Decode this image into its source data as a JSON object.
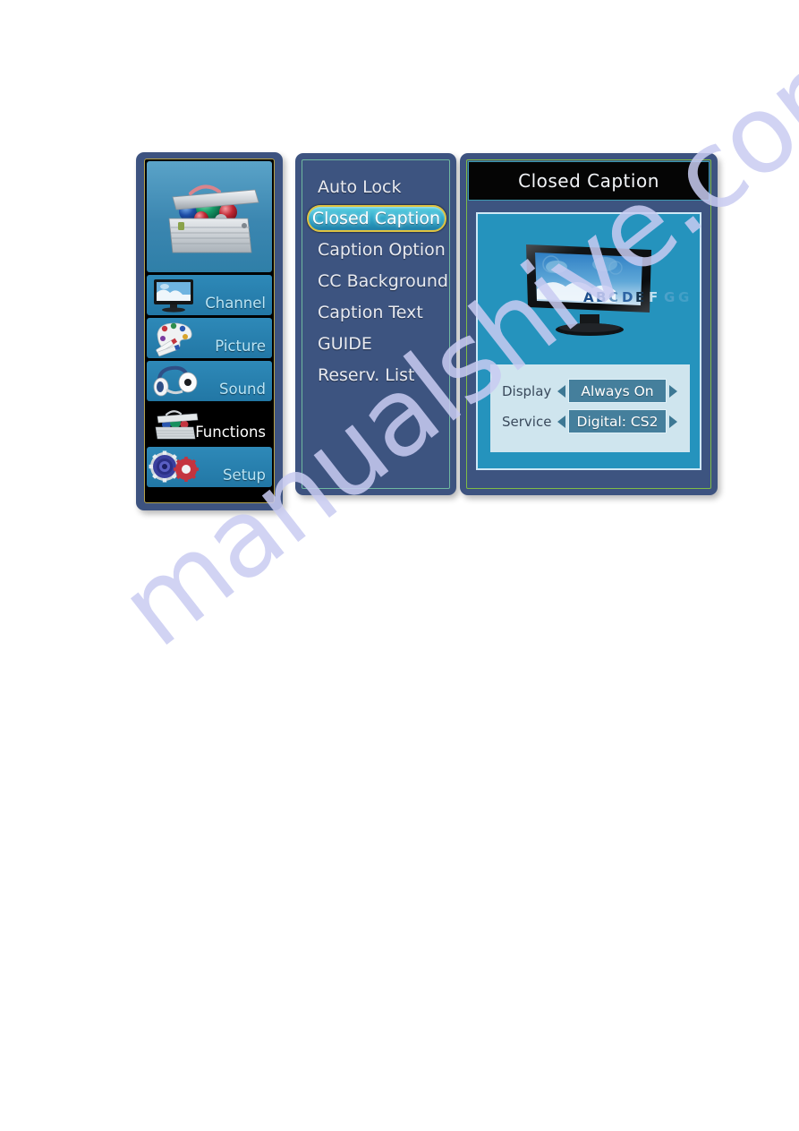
{
  "watermark": {
    "text": "manualshive.com"
  },
  "sidebar": {
    "hero_icon": "toolbox-icon",
    "items": [
      {
        "label": "Channel",
        "icon": "tv-monitor-icon",
        "selected": false
      },
      {
        "label": "Picture",
        "icon": "paint-palette-icon",
        "selected": false
      },
      {
        "label": "Sound",
        "icon": "headphones-icon",
        "selected": false
      },
      {
        "label": "Functions",
        "icon": "toolbox-icon",
        "selected": true
      },
      {
        "label": "Setup",
        "icon": "gears-icon",
        "selected": false
      }
    ]
  },
  "menu": {
    "items": [
      {
        "label": "Auto Lock",
        "highlighted": false
      },
      {
        "label": "Closed Caption",
        "highlighted": true
      },
      {
        "label": "Caption Option",
        "highlighted": false
      },
      {
        "label": "CC Background",
        "highlighted": false
      },
      {
        "label": "Caption Text",
        "highlighted": false
      },
      {
        "label": "GUIDE",
        "highlighted": false
      },
      {
        "label": "Reserv. List",
        "highlighted": false
      }
    ]
  },
  "detail": {
    "title": "Closed Caption",
    "preview": {
      "illustration": "tv-with-captions-icon",
      "letters": "ABCDEFG"
    },
    "settings": [
      {
        "label": "Display",
        "value": "Always On",
        "left_arrow": "arrow-left-icon",
        "right_arrow": "arrow-right-icon"
      },
      {
        "label": "Service",
        "value": "Digital: CS2",
        "left_arrow": "arrow-left-icon",
        "right_arrow": "arrow-right-icon"
      }
    ]
  },
  "colors": {
    "panel_bg": "#3d5380",
    "menu_bg": "#3d5480",
    "highlight_fill": "#2fa8c9",
    "highlight_border": "#e0c340",
    "tile_blue": "#2277a5",
    "selected_tile": "#000000",
    "preview_bg": "#2593bd",
    "settings_card_bg": "#cfe5ee",
    "value_box_bg": "#457f9c",
    "titlebar_bg": "#050505",
    "watermark_color": "#c9ccf2"
  }
}
